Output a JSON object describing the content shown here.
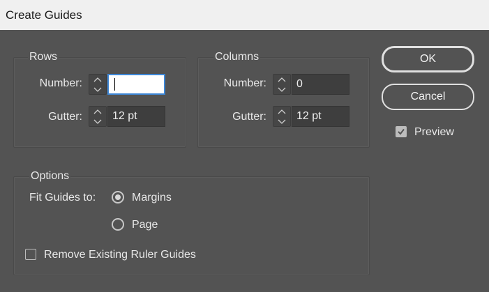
{
  "window": {
    "title": "Create Guides"
  },
  "rows": {
    "title": "Rows",
    "number_label": "Number:",
    "number_value": "",
    "gutter_label": "Gutter:",
    "gutter_value": "12 pt"
  },
  "columns": {
    "title": "Columns",
    "number_label": "Number:",
    "number_value": "0",
    "gutter_label": "Gutter:",
    "gutter_value": "12 pt"
  },
  "options": {
    "title": "Options",
    "fit_label": "Fit Guides to:",
    "fit_choices": [
      {
        "label": "Margins",
        "selected": true
      },
      {
        "label": "Page",
        "selected": false
      }
    ],
    "remove_label": "Remove Existing Ruler Guides",
    "remove_checked": false
  },
  "buttons": {
    "ok": "OK",
    "cancel": "Cancel"
  },
  "preview": {
    "label": "Preview",
    "checked": true
  },
  "icons": {
    "spinner_up": "chevron-up-icon",
    "spinner_down": "chevron-down-icon",
    "check": "checkmark-icon"
  },
  "colors": {
    "dialog_bg": "#535353",
    "titlebar_bg": "#f0f0f0",
    "focus_ring": "#3d86d6"
  }
}
